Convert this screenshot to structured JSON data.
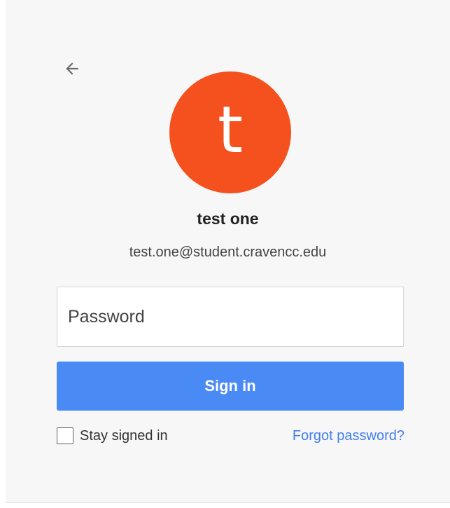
{
  "colors": {
    "accent": "#4a8af4",
    "avatar_bg": "#f4511e",
    "link": "#427fed"
  },
  "navigation": {
    "back_icon": "arrow-back-icon"
  },
  "account": {
    "avatar_letter": "t",
    "name": "test one",
    "email": "test.one@student.cravencc.edu"
  },
  "form": {
    "password_value": "",
    "password_placeholder": "Password",
    "signin_label": "Sign in",
    "stay_signed_in_label": "Stay signed in",
    "stay_signed_in_checked": false,
    "forgot_password_label": "Forgot password?"
  }
}
